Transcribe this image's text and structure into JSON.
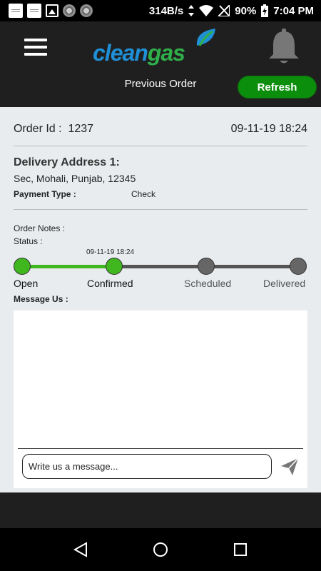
{
  "status_bar": {
    "net_speed": "314B/s",
    "battery": "90%",
    "time": "7:04 PM"
  },
  "header": {
    "logo_clean": "clean",
    "logo_gas": "gas",
    "subtitle": "Previous Order",
    "refresh_label": "Refresh"
  },
  "order": {
    "id_label": "Order Id :",
    "id_value": "1237",
    "datetime": "09-11-19 18:24",
    "address_title": "Delivery Address 1:",
    "address": "Sec, Mohali, Punjab, 12345",
    "payment_label": "Payment Type :",
    "payment_value": "Check",
    "notes_label": "Order Notes :",
    "status_label": "Status :"
  },
  "progress": {
    "current_step_date": "09-11-19 18:24",
    "steps": [
      {
        "label": "Open",
        "done": true
      },
      {
        "label": "Confirmed",
        "done": true
      },
      {
        "label": "Scheduled",
        "done": false
      },
      {
        "label": "Delivered",
        "done": false
      }
    ],
    "colors": {
      "done": "#41b71f",
      "todo": "#666666"
    }
  },
  "message": {
    "title": "Message Us :",
    "placeholder": "Write us a message..."
  }
}
